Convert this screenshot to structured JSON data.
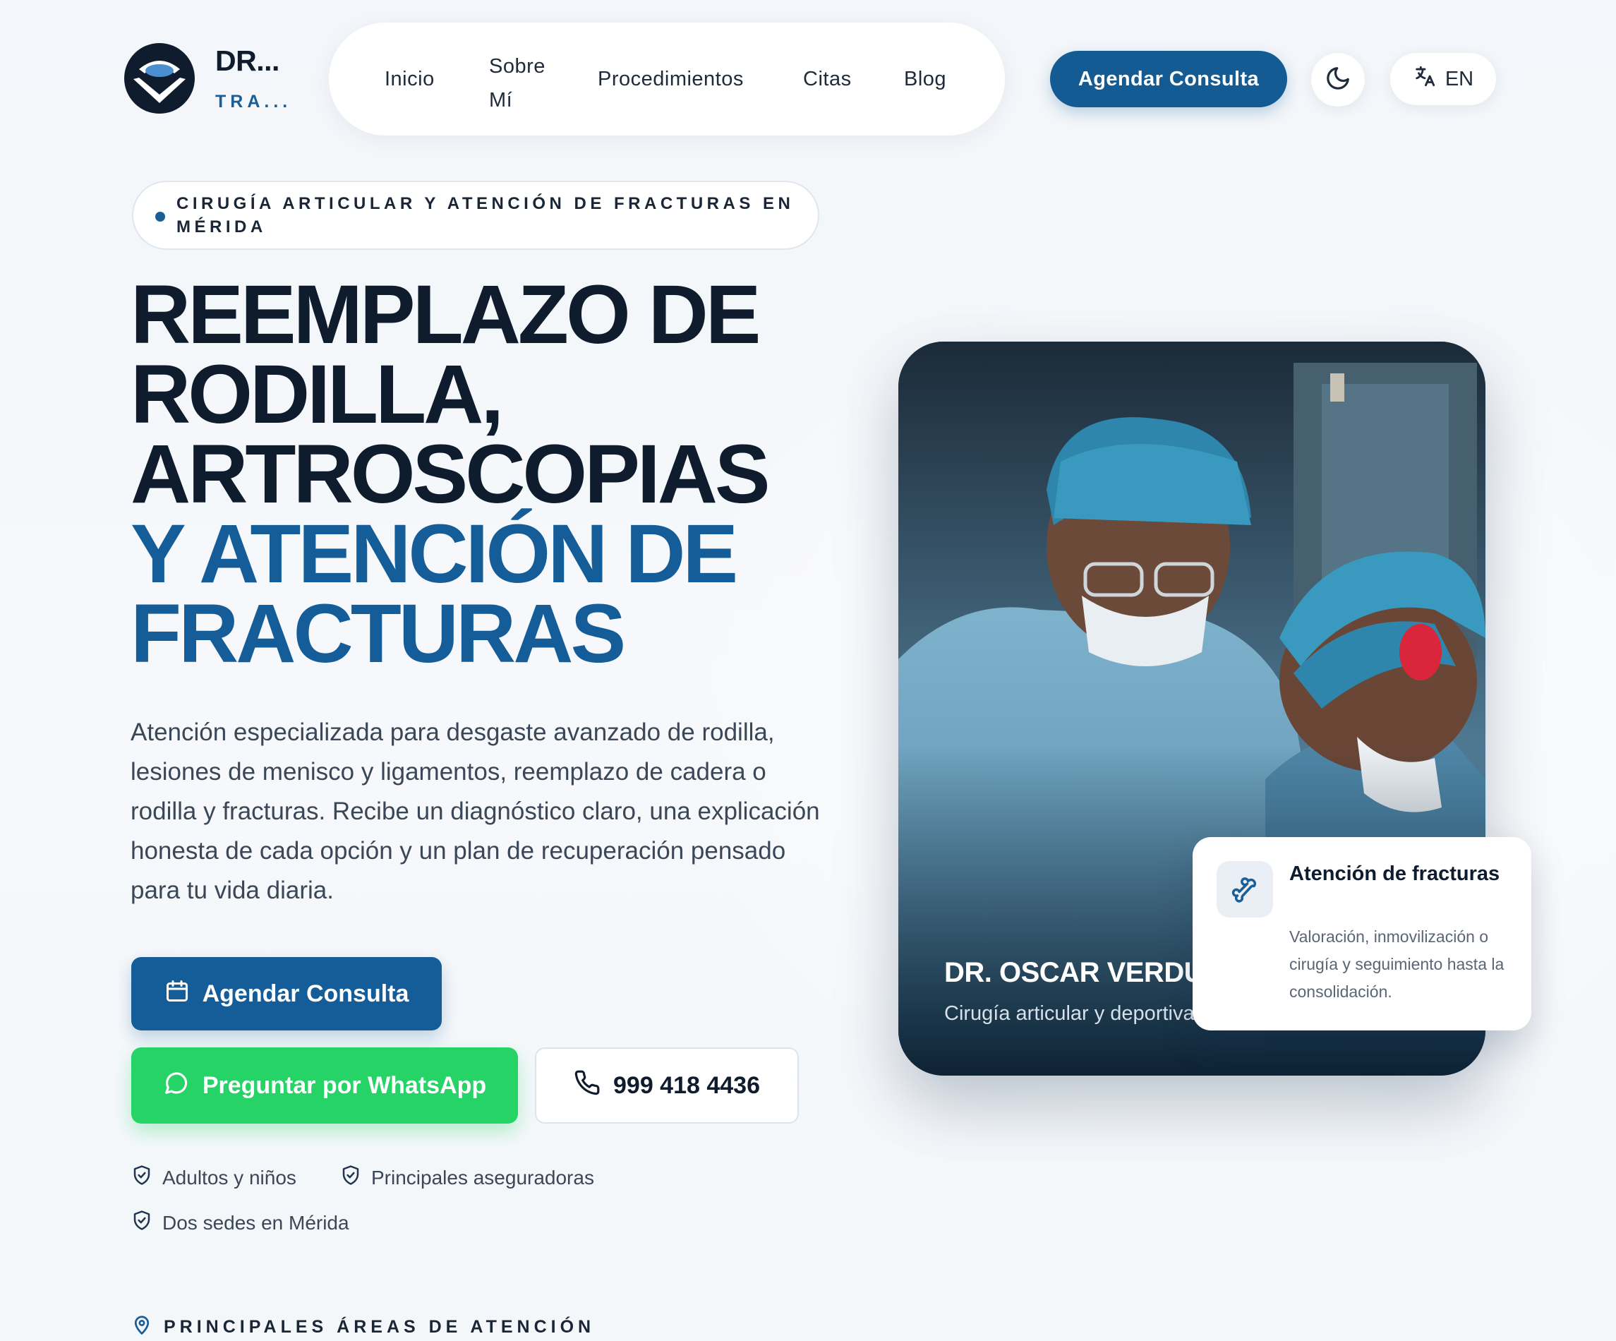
{
  "header": {
    "brand_name": "DR...",
    "brand_sub": "TRA...",
    "nav": [
      "Inicio",
      "Sobre Mí",
      "Procedimientos",
      "Citas",
      "Blog"
    ],
    "cta_label": "Agendar Consulta",
    "lang_label": "EN"
  },
  "hero": {
    "eyebrow": "CIRUGÍA ARTICULAR Y ATENCIÓN DE FRACTURAS EN MÉRIDA",
    "headline_dark": "REEMPLAZO DE RODILLA, ARTROSCOPIAS",
    "headline_blue": "Y ATENCIÓN DE FRACTURAS",
    "lead": "Atención especializada para desgaste avanzado de rodilla, lesiones de menisco y ligamentos, reemplazo de cadera o rodilla y fracturas. Recibe un diagnóstico claro, una explicación honesta de cada opción y un plan de recuperación pensado para tu vida diaria.",
    "cta_primary": "Agendar Consulta",
    "cta_whatsapp": "Preguntar por WhatsApp",
    "phone": "999 418 4436",
    "badges": [
      "Adultos y niños",
      "Principales aseguradoras",
      "Dos sedes en Mérida"
    ],
    "areas_label": "PRINCIPALES ÁREAS DE ATENCIÓN"
  },
  "photo_card": {
    "doctor_name": "DR. OSCAR VERDU",
    "doctor_role": "Cirugía articular y deportiva"
  },
  "float_card": {
    "title": "Atención de fracturas",
    "description": "Valoración, inmovilización o cirugía y seguimiento hasta la consolidación."
  },
  "colors": {
    "brand_blue": "#155d98",
    "navy": "#0f1c2e",
    "whatsapp_green": "#25d366"
  },
  "icons": [
    "logo-mark",
    "moon-icon",
    "translate-icon",
    "calendar-icon",
    "whatsapp-icon",
    "phone-icon",
    "shield-check-icon",
    "map-pin-icon",
    "bone-icon"
  ]
}
